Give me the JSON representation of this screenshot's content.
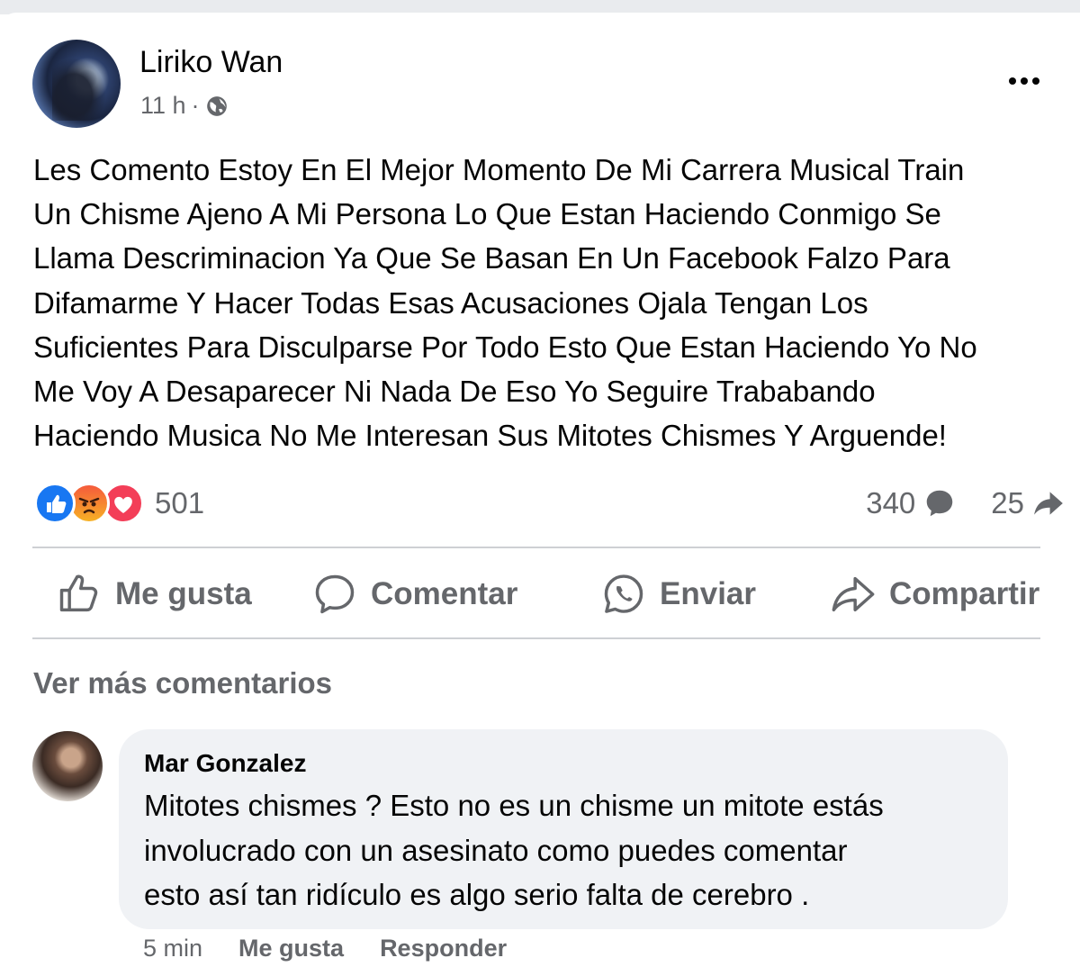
{
  "post": {
    "author": "Liriko Wan",
    "time": "11 h",
    "separator": "·",
    "text": "Les Comento Estoy En El Mejor Momento De Mi Carrera Musical Train\nUn Chisme Ajeno A Mi Persona Lo Que Estan Haciendo Conmigo Se\nLlama Descriminacion Ya Que Se Basan En Un Facebook Falzo Para\nDifamarme Y Hacer Todas Esas Acusaciones Ojala Tengan Los\nSuficientes Para Disculparse Por Todo Esto Que Estan Haciendo Yo No\nMe Voy A Desaparecer Ni Nada De Eso Yo Seguire Trababando\nHaciendo Musica No Me Interesan Sus Mitotes Chismes Y Arguende!",
    "reaction_count": "501",
    "comment_count": "340",
    "share_count": "25",
    "reactions": [
      "like-icon",
      "angry-icon",
      "love-icon"
    ]
  },
  "actions": {
    "like": "Me gusta",
    "comment": "Comentar",
    "send": "Enviar",
    "share": "Compartir"
  },
  "comments_section": {
    "more_label": "Ver más comentarios"
  },
  "comment": {
    "author": "Mar Gonzalez",
    "text": "Mitotes chismes ? Esto no es un chisme un mitote estás\ninvolucrado con un asesinato como puedes comentar\nesto así tan ridículo es algo serio falta de cerebro .",
    "time": "5 min",
    "like_label": "Me gusta",
    "reply_label": "Responder"
  },
  "colors": {
    "text": "#050505",
    "secondary": "#65676b",
    "like_blue": "#1877f2",
    "love_red": "#f33e58",
    "bubble": "#f0f2f5"
  }
}
